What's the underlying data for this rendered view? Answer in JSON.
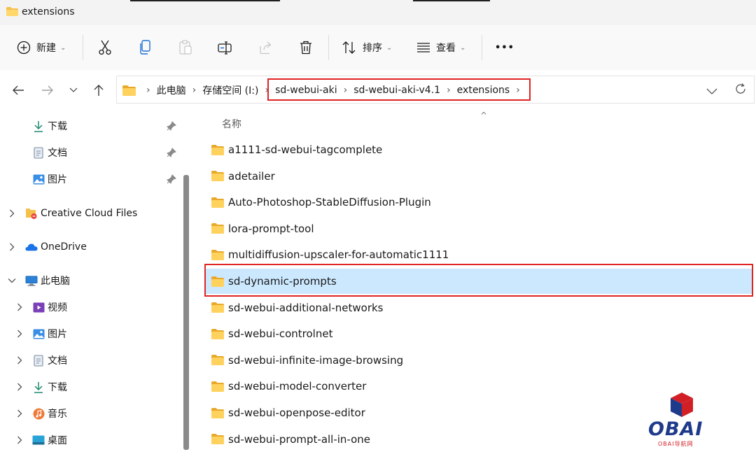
{
  "window": {
    "title": "extensions"
  },
  "toolbar": {
    "new_label": "新建",
    "sort_label": "排序",
    "view_label": "查看",
    "more_label": "•••"
  },
  "address": {
    "crumbs": [
      "此电脑",
      "存储空间 (I:)",
      "sd-webui-aki",
      "sd-webui-aki-v4.1",
      "extensions"
    ]
  },
  "sidebar": {
    "quick": [
      {
        "label": "下载",
        "icon": "download-icon"
      },
      {
        "label": "文档",
        "icon": "document-icon"
      },
      {
        "label": "图片",
        "icon": "picture-icon"
      }
    ],
    "creative_cloud": "Creative Cloud Files",
    "onedrive": "OneDrive",
    "this_pc": "此电脑",
    "pc_children": [
      {
        "label": "视频",
        "icon": "video-icon"
      },
      {
        "label": "图片",
        "icon": "picture-icon"
      },
      {
        "label": "文档",
        "icon": "document-icon"
      },
      {
        "label": "下载",
        "icon": "download-icon"
      },
      {
        "label": "音乐",
        "icon": "music-icon"
      },
      {
        "label": "桌面",
        "icon": "desktop-icon"
      }
    ]
  },
  "content": {
    "column_name": "名称",
    "folders": [
      "a1111-sd-webui-tagcomplete",
      "adetailer",
      "Auto-Photoshop-StableDiffusion-Plugin",
      "lora-prompt-tool",
      "multidiffusion-upscaler-for-automatic1111",
      "sd-dynamic-prompts",
      "sd-webui-additional-networks",
      "sd-webui-controlnet",
      "sd-webui-infinite-image-browsing",
      "sd-webui-model-converter",
      "sd-webui-openpose-editor",
      "sd-webui-prompt-all-in-one"
    ],
    "selected_folder": "sd-dynamic-prompts"
  },
  "watermark": {
    "brand": "OBAI",
    "sub": "OBAI导航网"
  },
  "colors": {
    "highlight_red": "#e02424",
    "selected_row": "#cce8ff",
    "folder_yellow": "#f5c14b",
    "accent_blue": "#1a73e8"
  }
}
